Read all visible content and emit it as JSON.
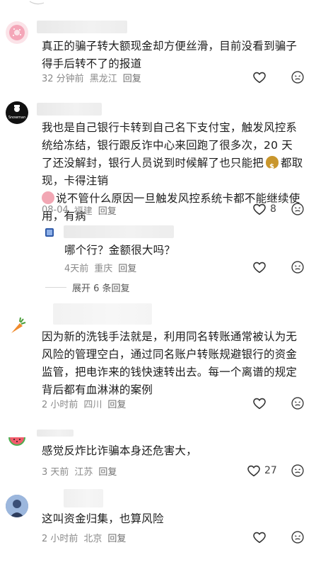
{
  "comments": [
    {
      "text": "真正的骗子转大额现金却方便丝滑，目前没看到骗子得手后转不了的报道",
      "time": "32 分钟前",
      "location": "黑龙江",
      "reply_label": "回复",
      "likes": ""
    },
    {
      "text_parts": [
        "我也是自己银行卡转到自己名下支付宝，触发风控系统给冻结，银行跟反诈中心来回跑了很多次，20 天了还没解封，银行人员说到时候解了也只能把",
        "都取现，卡得注销",
        "说不管什么原因一旦触发风控系统卡都不能继续使用，有病"
      ],
      "time": "08-04",
      "location": "福建",
      "reply_label": "回复",
      "likes": "8"
    },
    {
      "text": "哪个行？金额很大吗？",
      "time": "4天前",
      "location": "重庆",
      "reply_label": "回复",
      "likes": ""
    },
    {
      "text": "因为新的洗钱手法就是，利用同名转账通常被认为无风险的管理空白，通过同名账户转账规避银行的资金监管，把电诈来的钱快速转出去。每一个离谱的规定背后都有血淋淋的案例",
      "time": "2 小时前",
      "location": "四川",
      "reply_label": "回复",
      "likes": ""
    },
    {
      "text": "感觉反炸比诈骗本身还危害大，",
      "time": "3 天前",
      "location": "江苏",
      "reply_label": "回复",
      "likes": "27"
    },
    {
      "text": "这叫资金归集，也算风险",
      "time": "2 小时前",
      "location": "北京",
      "reply_label": "回复",
      "likes": ""
    }
  ],
  "expand_replies": "展开 6 条回复",
  "colors": {
    "text": "#1c1c1c",
    "meta": "#8a8a8a",
    "icon": "#333333"
  }
}
